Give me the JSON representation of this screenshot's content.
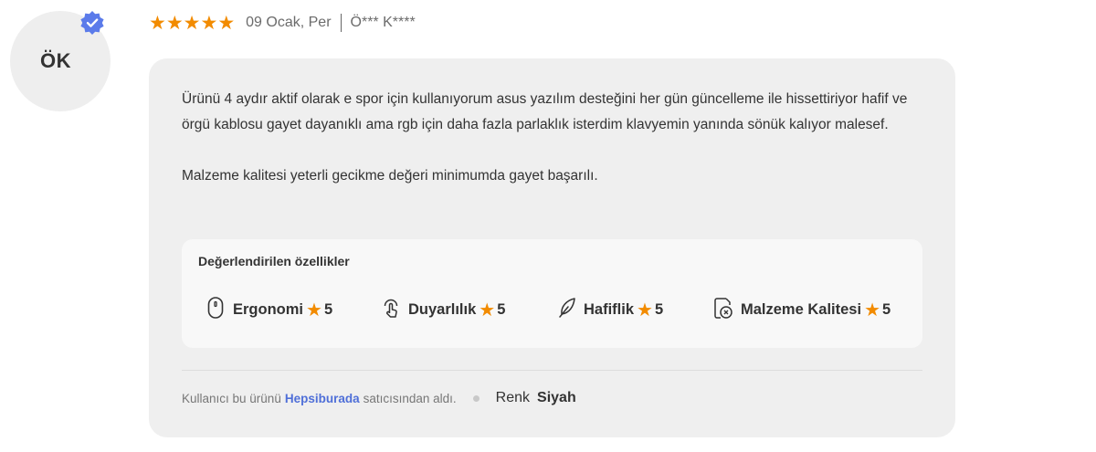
{
  "reviewer": {
    "initials": "ÖK",
    "name_masked": "Ö*** K****",
    "verified": true
  },
  "review": {
    "rating": 5,
    "star_glyph": "★",
    "date": "09 Ocak, Per",
    "text": "Ürünü 4 aydır aktif olarak e spor için kullanıyorum asus yazılım desteğini her gün güncelleme ile hissettiriyor hafif ve örgü kablosu gayet dayanıklı ama rgb için daha fazla parlaklık isterdim klavyemin yanında sönük kalıyor malesef.\n\nMalzeme kalitesi yeterli gecikme değeri minimumda gayet başarılı."
  },
  "features": {
    "title": "Değerlendirilen özellikler",
    "items": [
      {
        "label": "Ergonomi",
        "score": "5",
        "icon": "mouse-icon"
      },
      {
        "label": "Duyarlılık",
        "score": "5",
        "icon": "touch-icon"
      },
      {
        "label": "Hafiflik",
        "score": "5",
        "icon": "feather-icon"
      },
      {
        "label": "Malzeme Kalitesi",
        "score": "5",
        "icon": "material-quality-icon"
      }
    ]
  },
  "footer": {
    "seller_prefix": "Kullanıcı bu ürünü",
    "seller_name": "Hepsiburada",
    "seller_suffix": "satıcısından aldı.",
    "attribute_label": "Renk",
    "attribute_value": "Siyah"
  },
  "colors": {
    "star": "#f28b00",
    "verified_badge": "#5b7bea",
    "seller_link": "#4f6fd8",
    "card_bg": "#efefef"
  }
}
